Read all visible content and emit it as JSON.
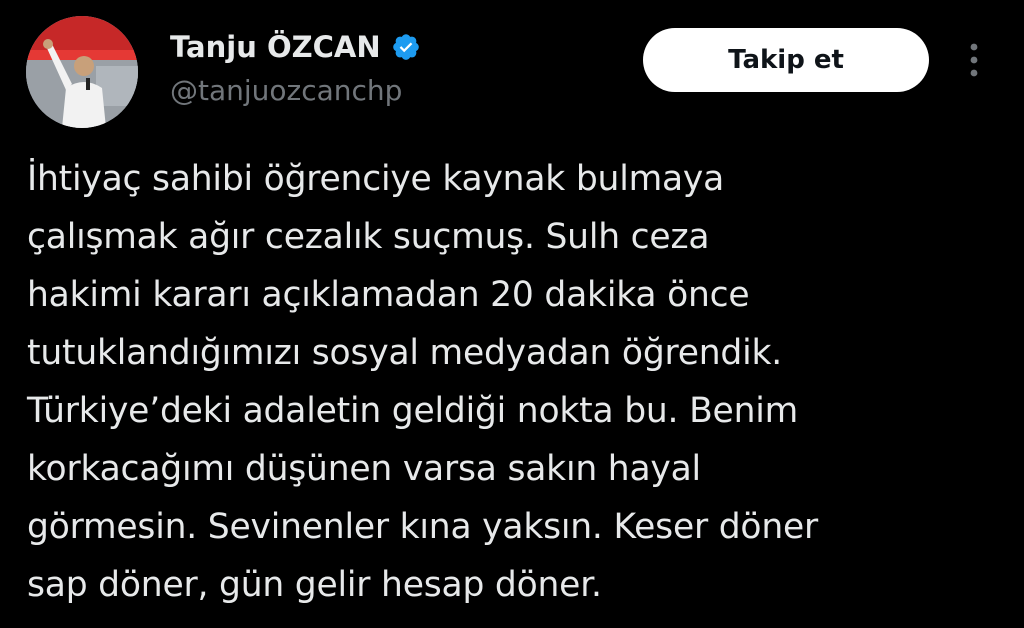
{
  "author": {
    "display_name": "Tanju ÖZCAN",
    "handle": "@tanjuozcanchp",
    "verified_icon": "verified-badge-icon",
    "avatar_icon": "avatar-photo"
  },
  "actions": {
    "follow_label": "Takip et",
    "more_icon": "more-options-icon"
  },
  "tweet": {
    "text": "İhtiyaç sahibi öğrenciye kaynak bulmaya\nçalışmak ağır cezalık suçmuş. Sulh ceza\nhakimi kararı açıklamadan 20 dakika önce\ntutuklandığımızı sosyal medyadan öğrendik.\nTürkiye’deki adaletin geldiği nokta bu. Benim\nkorkacağımı düşünen varsa sakın hayal\ngörmesin. Sevinenler kına yaksın. Keser döner\nsap döner, gün gelir hesap döner."
  },
  "colors": {
    "background": "#000000",
    "text_primary": "#e7e9ea",
    "text_secondary": "#71767b",
    "verified_blue": "#1d9bf0",
    "follow_bg": "#ffffff",
    "follow_text": "#0f1419"
  }
}
